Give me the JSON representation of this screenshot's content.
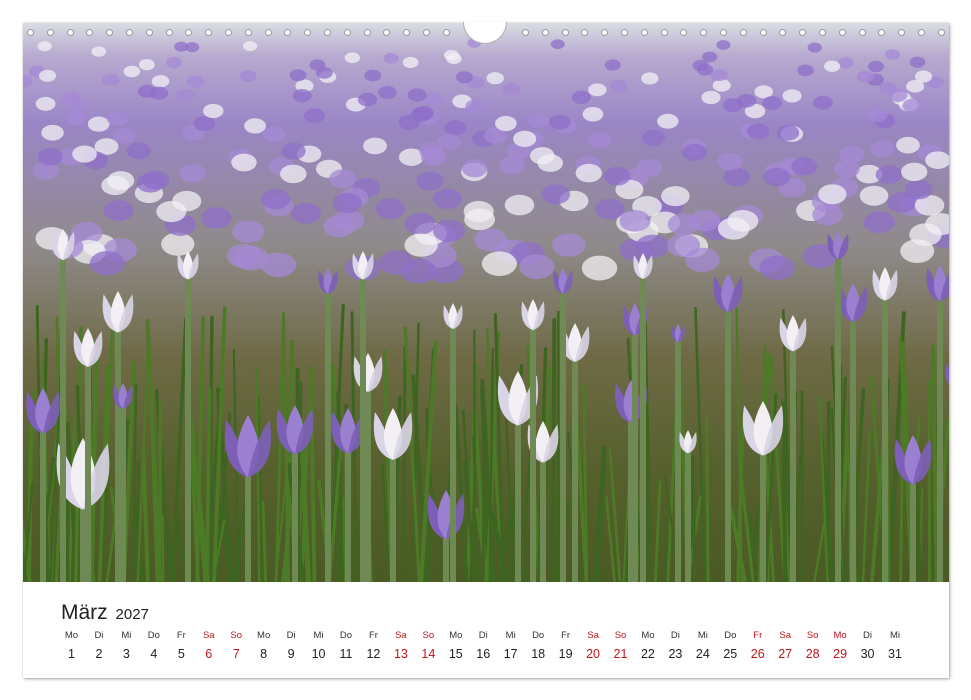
{
  "calendar": {
    "month": "März",
    "year": "2027",
    "days": [
      {
        "abbr": "Mo",
        "num": "1",
        "red": false
      },
      {
        "abbr": "Di",
        "num": "2",
        "red": false
      },
      {
        "abbr": "Mi",
        "num": "3",
        "red": false
      },
      {
        "abbr": "Do",
        "num": "4",
        "red": false
      },
      {
        "abbr": "Fr",
        "num": "5",
        "red": false
      },
      {
        "abbr": "Sa",
        "num": "6",
        "red": true
      },
      {
        "abbr": "So",
        "num": "7",
        "red": true
      },
      {
        "abbr": "Mo",
        "num": "8",
        "red": false
      },
      {
        "abbr": "Di",
        "num": "9",
        "red": false
      },
      {
        "abbr": "Mi",
        "num": "10",
        "red": false
      },
      {
        "abbr": "Do",
        "num": "11",
        "red": false
      },
      {
        "abbr": "Fr",
        "num": "12",
        "red": false
      },
      {
        "abbr": "Sa",
        "num": "13",
        "red": true
      },
      {
        "abbr": "So",
        "num": "14",
        "red": true
      },
      {
        "abbr": "Mo",
        "num": "15",
        "red": false
      },
      {
        "abbr": "Di",
        "num": "16",
        "red": false
      },
      {
        "abbr": "Mi",
        "num": "17",
        "red": false
      },
      {
        "abbr": "Do",
        "num": "18",
        "red": false
      },
      {
        "abbr": "Fr",
        "num": "19",
        "red": false
      },
      {
        "abbr": "Sa",
        "num": "20",
        "red": true
      },
      {
        "abbr": "So",
        "num": "21",
        "red": true
      },
      {
        "abbr": "Mo",
        "num": "22",
        "red": false
      },
      {
        "abbr": "Di",
        "num": "23",
        "red": false
      },
      {
        "abbr": "Mi",
        "num": "24",
        "red": false
      },
      {
        "abbr": "Do",
        "num": "25",
        "red": false
      },
      {
        "abbr": "Fr",
        "num": "26",
        "red": true
      },
      {
        "abbr": "Sa",
        "num": "27",
        "red": true
      },
      {
        "abbr": "So",
        "num": "28",
        "red": true
      },
      {
        "abbr": "Mo",
        "num": "29",
        "red": true
      },
      {
        "abbr": "Di",
        "num": "30",
        "red": false
      },
      {
        "abbr": "Mi",
        "num": "31",
        "red": false
      }
    ]
  },
  "colors": {
    "holiday_red": "#c0151b",
    "crocus_purple": "#9b7fd0",
    "crocus_white": "#f2f0f4",
    "grass_green": "#4f6b2a"
  },
  "photo": {
    "subject": "crocus-meadow-photo"
  }
}
